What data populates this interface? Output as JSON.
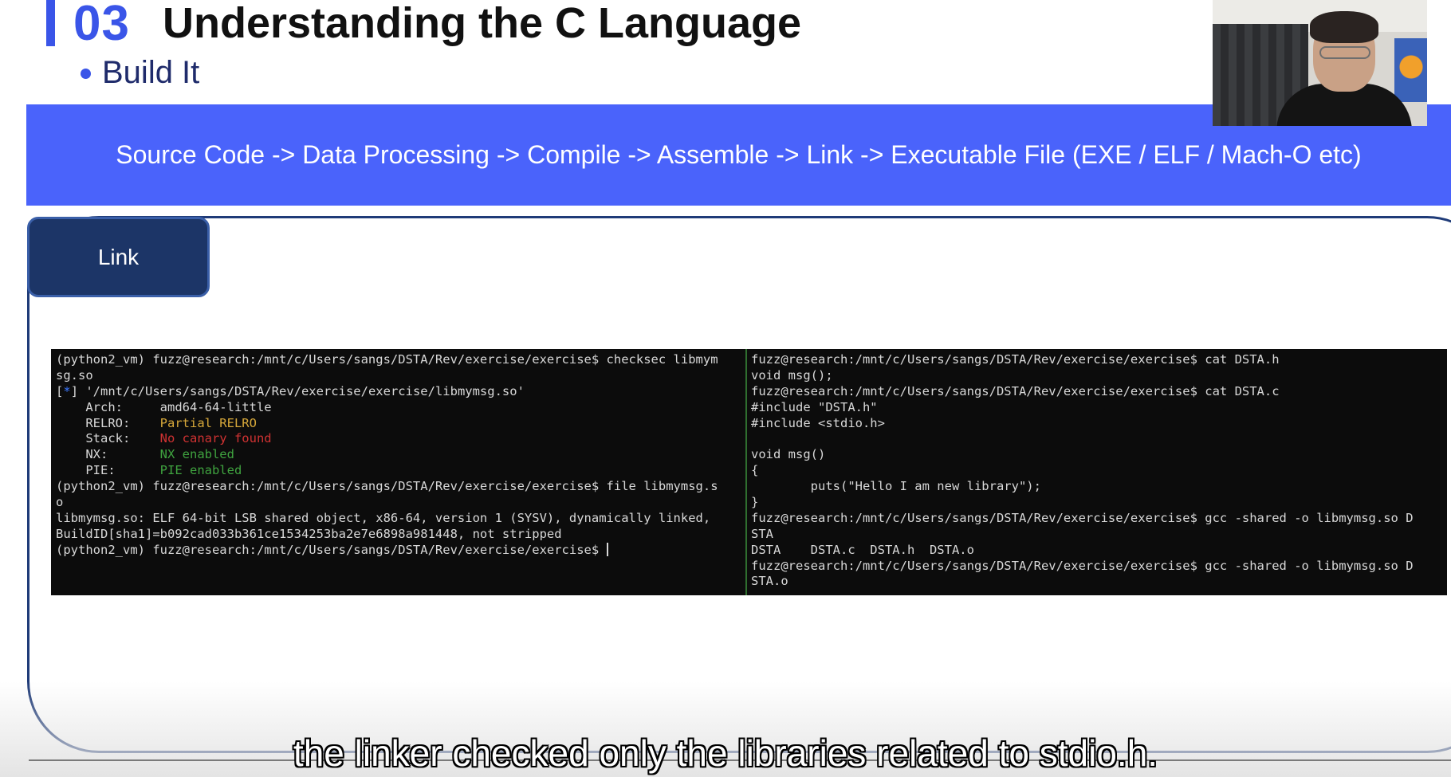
{
  "slide": {
    "section_number": "03",
    "title": "Understanding the C Language",
    "bullet": "Build It"
  },
  "pipeline": "Source Code -> Data Processing -> Compile -> Assemble -> Link -> Executable File (EXE / ELF / Mach-O etc)",
  "tag": "Link",
  "terminal": {
    "left_pane": {
      "l1": "(python2_vm) fuzz@research:/mnt/c/Users/sangs/DSTA/Rev/exercise/exercise$ checksec libmym",
      "l2": "sg.so",
      "l3_bracket_open": "[",
      "l3_star": "*",
      "l3_rest": "] '/mnt/c/Users/sangs/DSTA/Rev/exercise/exercise/libmymsg.so'",
      "arch_label": "    Arch:     ",
      "arch_value": "amd64-64-little",
      "relro_label": "    RELRO:    ",
      "relro_value": "Partial RELRO",
      "stack_label": "    Stack:    ",
      "stack_value": "No canary found",
      "nx_label": "    NX:       ",
      "nx_value": "NX enabled",
      "pie_label": "    PIE:      ",
      "pie_value": "PIE enabled",
      "l9": "(python2_vm) fuzz@research:/mnt/c/Users/sangs/DSTA/Rev/exercise/exercise$ file libmymsg.s",
      "l10": "o",
      "l11": "libmymsg.so: ELF 64-bit LSB shared object, x86-64, version 1 (SYSV), dynamically linked,",
      "l12": "BuildID[sha1]=b092cad033b361ce1534253ba2e7e6898a981448, not stripped",
      "l13": "(python2_vm) fuzz@research:/mnt/c/Users/sangs/DSTA/Rev/exercise/exercise$ "
    },
    "right_pane": {
      "r1": "fuzz@research:/mnt/c/Users/sangs/DSTA/Rev/exercise/exercise$ cat DSTA.h",
      "r2": "void msg();",
      "r3": "fuzz@research:/mnt/c/Users/sangs/DSTA/Rev/exercise/exercise$ cat DSTA.c",
      "r4": "#include \"DSTA.h\"",
      "r5": "#include <stdio.h>",
      "r6": "",
      "r7": "void msg()",
      "r8": "{",
      "r9": "        puts(\"Hello I am new library\");",
      "r10": "}",
      "r11": "fuzz@research:/mnt/c/Users/sangs/DSTA/Rev/exercise/exercise$ gcc -shared -o libmymsg.so D",
      "r12": "STA",
      "r13": "DSTA    DSTA.c  DSTA.h  DSTA.o",
      "r14": "fuzz@research:/mnt/c/Users/sangs/DSTA/Rev/exercise/exercise$ gcc -shared -o libmymsg.so D",
      "r15": "STA.o"
    }
  },
  "caption": "the linker checked only the libraries related to stdio.h.",
  "colors": {
    "accent": "#3a55e8",
    "banner": "#4a63fb",
    "tag": "#1c3567",
    "terminal_bg": "#0c0c0c",
    "warn": "#d7a83a",
    "error": "#d03232",
    "ok": "#3fa33f"
  }
}
